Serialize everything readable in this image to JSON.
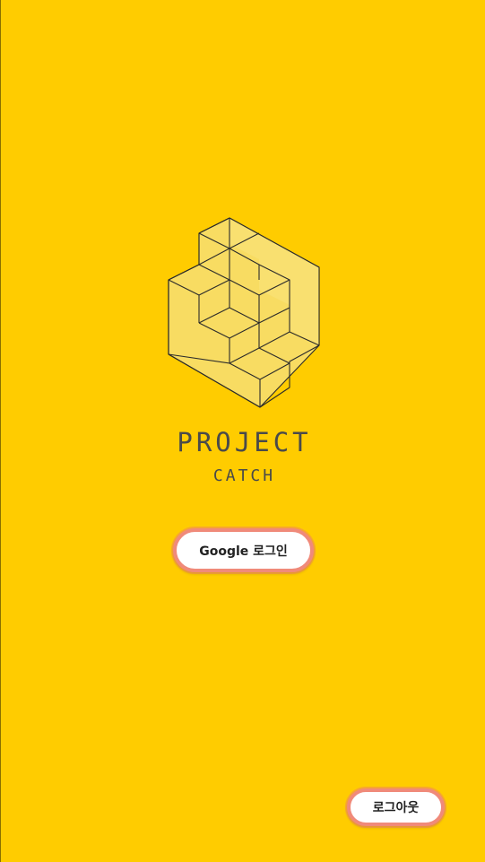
{
  "app": {
    "title": "PROJECT",
    "subtitle": "CATCH",
    "background_color": "#FFCC00",
    "accent_color": "#F08A7A"
  },
  "logo": {
    "icon": "isometric-stairs-cube-icon"
  },
  "buttons": {
    "google_login_label": "Google 로그인",
    "logout_label": "로그아웃"
  }
}
